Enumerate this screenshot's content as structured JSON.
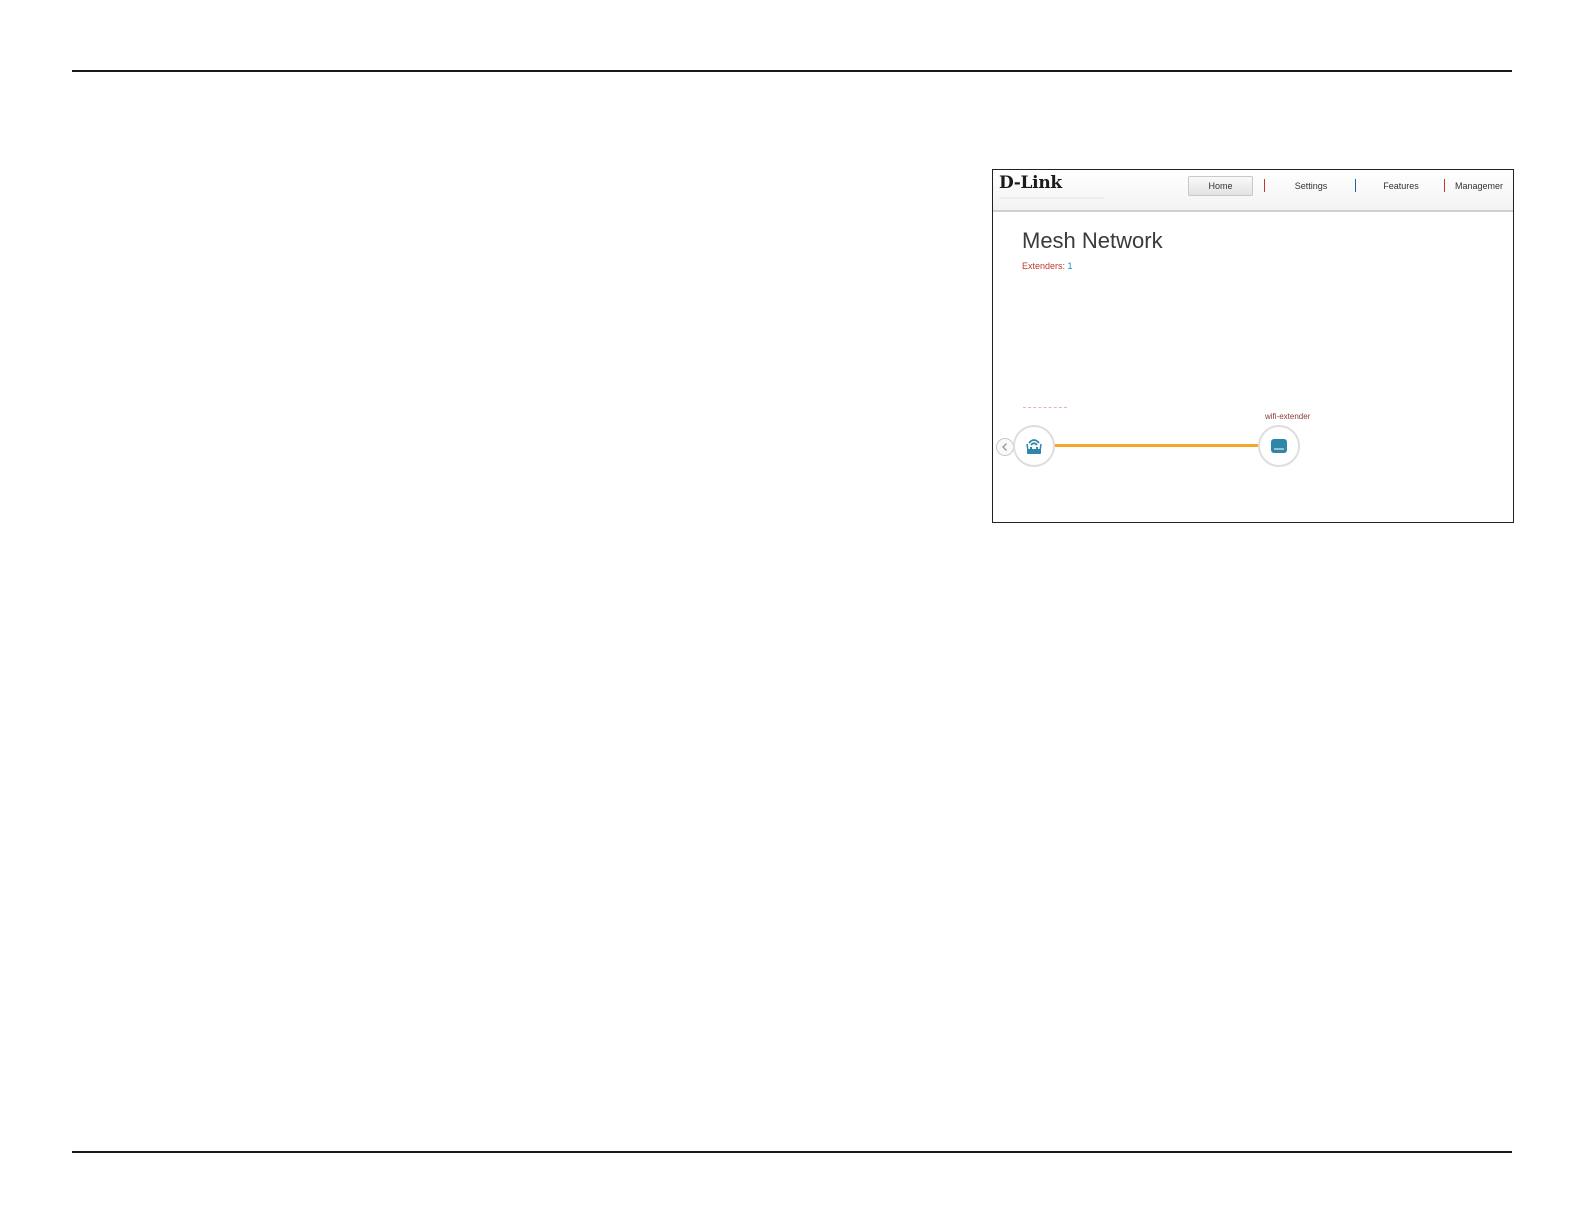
{
  "topbar": {
    "brand": "D-Link",
    "nav": [
      {
        "label": "Home",
        "active": true
      },
      {
        "label": "Settings",
        "active": false
      },
      {
        "label": "Features",
        "active": false
      },
      {
        "label": "Managemer",
        "active": false
      }
    ],
    "separator_colors": [
      "#c0392b",
      "#1e5fa8",
      "#c0392b"
    ]
  },
  "main": {
    "title": "Mesh Network",
    "extenders_label": "Extenders:",
    "extenders_count": "1"
  },
  "topology": {
    "router_label": "",
    "extender_label": "wifi-extender",
    "link_color": "#f4a62b",
    "icon_color": "#2f86a8"
  }
}
